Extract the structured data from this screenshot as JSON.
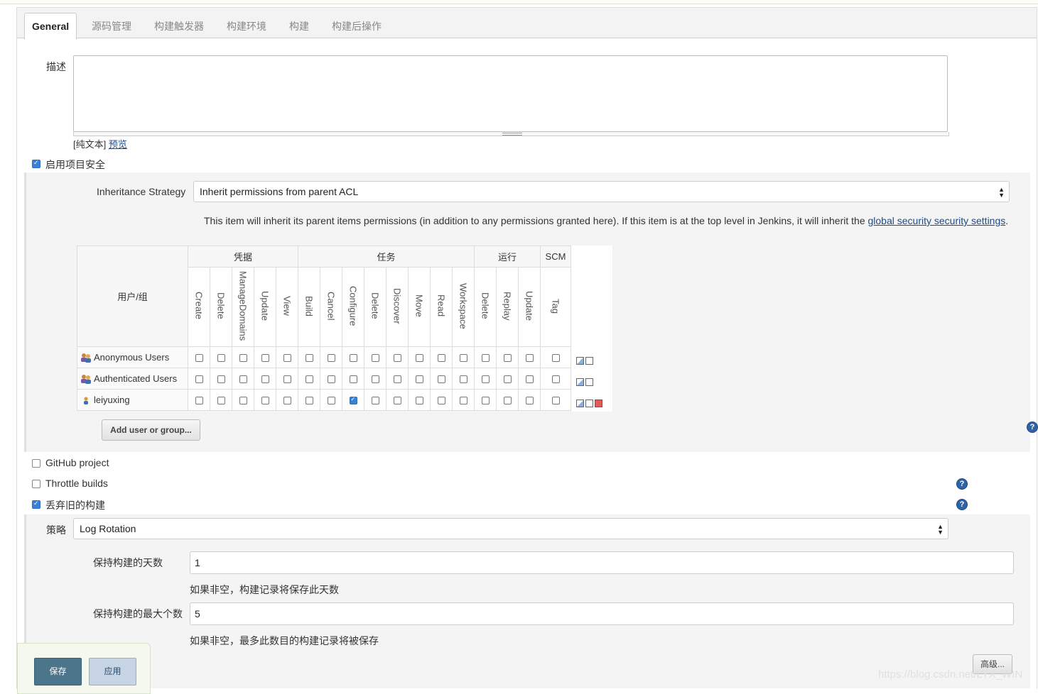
{
  "tabs": [
    "General",
    "源码管理",
    "构建触发器",
    "构建环境",
    "构建",
    "构建后操作"
  ],
  "description": {
    "label": "描述",
    "value": "",
    "plain_text": "[纯文本]",
    "preview": "预览"
  },
  "project_security": {
    "label": "启用项目安全",
    "checked": true,
    "inheritance_label": "Inheritance Strategy",
    "inheritance_value": "Inherit permissions from parent ACL",
    "info_text": "This item will inherit its parent items permissions (in addition to any permissions granted here). If this item is at the top level in Jenkins, it will inherit the ",
    "info_link": "global security security settings",
    "info_end": ".",
    "matrix": {
      "user_header": "用户/组",
      "groups": [
        {
          "name": "凭据",
          "perms": [
            "Create",
            "Delete",
            "ManageDomains",
            "Update",
            "View"
          ]
        },
        {
          "name": "任务",
          "perms": [
            "Build",
            "Cancel",
            "Configure",
            "Delete",
            "Discover",
            "Move",
            "Read",
            "Workspace"
          ]
        },
        {
          "name": "运行",
          "perms": [
            "Delete",
            "Replay",
            "Update"
          ]
        },
        {
          "name": "SCM",
          "perms": [
            "Tag"
          ]
        }
      ],
      "rows": [
        {
          "name": "Anonymous Users",
          "type": "group",
          "checked": [],
          "removable": false
        },
        {
          "name": "Authenticated Users",
          "type": "group",
          "checked": [],
          "removable": false
        },
        {
          "name": "leiyuxing",
          "type": "user",
          "checked": [
            7
          ],
          "removable": true
        }
      ]
    },
    "add_button": "Add user or group..."
  },
  "options": {
    "github_project": {
      "label": "GitHub project",
      "checked": false
    },
    "throttle_builds": {
      "label": "Throttle builds",
      "checked": false
    },
    "discard_old": {
      "label": "丢弃旧的构建",
      "checked": true
    }
  },
  "discard": {
    "strategy_label": "策略",
    "strategy_value": "Log Rotation",
    "days_label": "保持构建的天数",
    "days_value": "1",
    "days_hint": "如果非空，构建记录将保存此天数",
    "max_label": "保持构建的最大个数",
    "max_value": "5",
    "max_hint": "如果非空，最多此数目的构建记录将被保存",
    "advanced": "高级..."
  },
  "buttons": {
    "save": "保存",
    "apply": "应用"
  },
  "watermark": "https://blog.csdn.net/LYX_WIN",
  "colors": {
    "save_bg": "#4b758b",
    "apply_bg": "#c6d4e3",
    "link": "#204a87",
    "check": "#3b82d6"
  }
}
